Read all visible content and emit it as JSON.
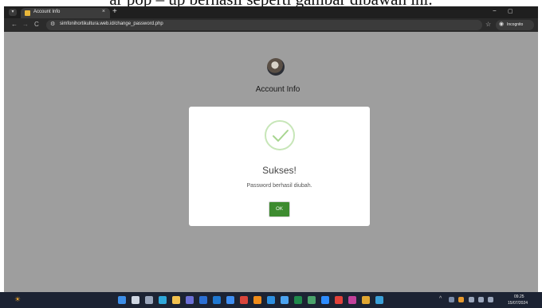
{
  "doc_caption": "ar pop – up berhasil seperti gambar dibawah ini.",
  "browser": {
    "tab_title": "Account Info",
    "tab_close": "×",
    "new_tab": "+",
    "minimize": "−",
    "maximize": "▢",
    "back": "←",
    "forward": "→",
    "reload": "C",
    "url": "simfonihortikultura.web.id/change_password.php",
    "bookmark": "☆",
    "incognito_label": "Incognito"
  },
  "page": {
    "title": "Account Info"
  },
  "modal": {
    "title": "Sukses!",
    "message": "Password berhasil diubah.",
    "ok_label": "OK",
    "icon": "check-icon",
    "accent_color": "#3d8b2f"
  },
  "taskbar": {
    "time": "09.25",
    "date": "15/07/2024",
    "apps": [
      {
        "name": "start-icon",
        "color": "#3d8ee8"
      },
      {
        "name": "search-icon",
        "color": "#cfd6e2"
      },
      {
        "name": "task-view-icon",
        "color": "#9aa6bb"
      },
      {
        "name": "edge-icon",
        "color": "#2fa7d9"
      },
      {
        "name": "file-explorer-icon",
        "color": "#f2c14e"
      },
      {
        "name": "teams-icon",
        "color": "#6b6fd6"
      },
      {
        "name": "word-icon",
        "color": "#2b6fd3"
      },
      {
        "name": "outlook-icon",
        "color": "#1f78d1"
      },
      {
        "name": "dropbox-icon",
        "color": "#3f8ef2"
      },
      {
        "name": "pdf-icon",
        "color": "#d8453b"
      },
      {
        "name": "vlc-icon",
        "color": "#f08c1a"
      },
      {
        "name": "vscode-icon",
        "color": "#2d8fe0"
      },
      {
        "name": "store-icon",
        "color": "#4ba3f0"
      },
      {
        "name": "excel-icon",
        "color": "#1f8a4c"
      },
      {
        "name": "chrome-icon",
        "color": "#4aa36b"
      },
      {
        "name": "zoom-icon",
        "color": "#2d8cff"
      },
      {
        "name": "opera-icon",
        "color": "#e2413a"
      },
      {
        "name": "mail-icon",
        "color": "#c2409a"
      },
      {
        "name": "chrome-canary-icon",
        "color": "#e0a631"
      },
      {
        "name": "terminal-icon",
        "color": "#3aa0d8"
      }
    ]
  }
}
